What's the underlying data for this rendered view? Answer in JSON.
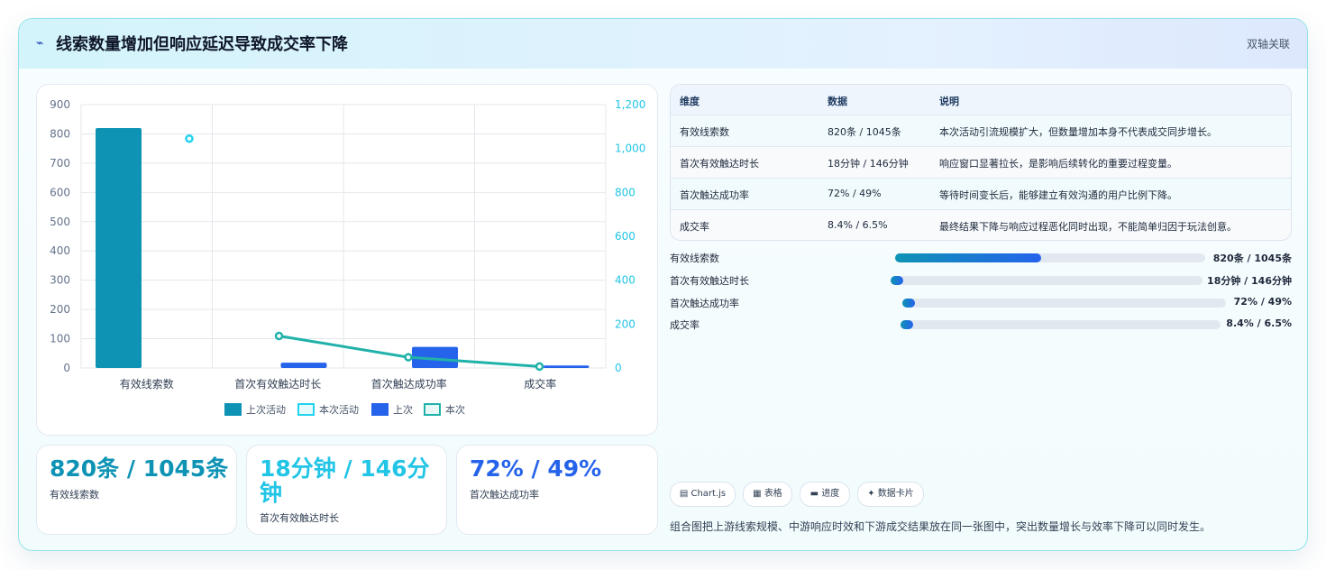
{
  "header": {
    "icon": "lightning-icon",
    "title": "线索数量增加但响应延迟导致成交率下降",
    "tag": "双轴关联"
  },
  "chart_data": {
    "type": "bar",
    "categories": [
      "有效线索数",
      "首次有效触达时长",
      "首次触达成功率",
      "成交率"
    ],
    "series": [
      {
        "name": "上次活动",
        "kind": "bar",
        "axis": "left",
        "color": "#0e93b5",
        "values": [
          820,
          0,
          0,
          0
        ]
      },
      {
        "name": "本次活动",
        "kind": "line",
        "axis": "right",
        "color": "#22d3ee",
        "values": [
          1045,
          null,
          null,
          null
        ]
      },
      {
        "name": "上次",
        "kind": "bar",
        "axis": "left",
        "color": "#2563eb",
        "values": [
          0,
          18,
          72,
          8.4
        ]
      },
      {
        "name": "本次",
        "kind": "line",
        "axis": "right",
        "color": "#20b2aa",
        "values": [
          null,
          146,
          49,
          6.5
        ]
      }
    ],
    "ylim": [
      0,
      900
    ],
    "yticks": [
      "900",
      "800",
      "700",
      "600",
      "500",
      "400",
      "300",
      "200",
      "100",
      "0"
    ],
    "y2lim": [
      0,
      1200
    ],
    "y2ticks": [
      "1,200",
      "1,000",
      "800",
      "600",
      "400",
      "200",
      "0"
    ],
    "grid": true,
    "legend_position": "bottom"
  },
  "kpis": [
    {
      "value": "820条 / 1045条",
      "label": "有效线索数",
      "color": "#0e93b5"
    },
    {
      "value": "18分钟 / 146分钟",
      "label": "首次有效触达时长",
      "color": "#22c5e6"
    },
    {
      "value": "72% / 49%",
      "label": "首次触达成功率",
      "color": "#2563eb"
    }
  ],
  "table": {
    "headers": [
      "维度",
      "数据",
      "说明"
    ],
    "rows": [
      [
        "有效线索数",
        "820条 / 1045条",
        "本次活动引流规模扩大，但数量增加本身不代表成交同步增长。"
      ],
      [
        "首次有效触达时长",
        "18分钟 / 146分钟",
        "响应窗口显著拉长，是影响后续转化的重要过程变量。"
      ],
      [
        "首次触达成功率",
        "72% / 49%",
        "等待时间变长后，能够建立有效沟通的用户比例下降。"
      ],
      [
        "成交率",
        "8.4% / 6.5%",
        "最终结果下降与响应过程恶化同时出现，不能简单归因于玩法创意。"
      ]
    ]
  },
  "progress": [
    {
      "label": "有效线索数",
      "value": "820条 / 1045条",
      "fraction": 0.47
    },
    {
      "label": "首次有效触达时长",
      "value": "18分钟 / 146分钟",
      "fraction": 0.04
    },
    {
      "label": "首次触达成功率",
      "value": "72% / 49%",
      "fraction": 0.04
    },
    {
      "label": "成交率",
      "value": "8.4% / 6.5%",
      "fraction": 0.04
    }
  ],
  "chips": [
    {
      "icon": "chart-icon",
      "glyph": "▤",
      "label": "Chart.js"
    },
    {
      "icon": "table-icon",
      "glyph": "▦",
      "label": "表格"
    },
    {
      "icon": "progress-icon",
      "glyph": "▬",
      "label": "进度"
    },
    {
      "icon": "sparkle-icon",
      "glyph": "✦",
      "label": "数据卡片"
    }
  ],
  "footer": "组合图把上游线索规模、中游响应时效和下游成交结果放在同一张图中，突出数量增长与效率下降可以同时发生。"
}
